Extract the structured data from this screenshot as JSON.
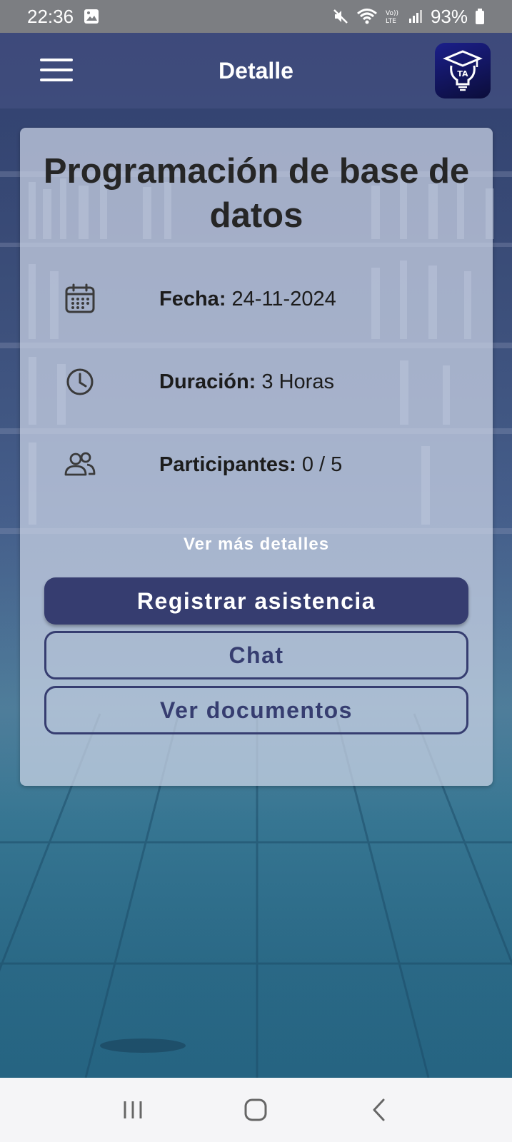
{
  "status_bar": {
    "time": "22:36",
    "battery": "93%",
    "icons": [
      "gallery-icon",
      "mute-icon",
      "wifi-icon",
      "volte-icon",
      "signal-icon",
      "battery-icon"
    ]
  },
  "app_bar": {
    "title": "Detalle",
    "menu_icon": "hamburger-menu-icon",
    "logo_text": "TA"
  },
  "card": {
    "title": "Programación de base de datos",
    "rows": [
      {
        "icon": "calendar-icon",
        "label": "Fecha:",
        "value": " 24-11-2024"
      },
      {
        "icon": "clock-icon",
        "label": "Duración:",
        "value": " 3 Horas"
      },
      {
        "icon": "participants-icon",
        "label": "Participantes:",
        "value": " 0 / 5"
      }
    ],
    "more_link": "Ver más detalles",
    "buttons": {
      "register": "Registrar asistencia",
      "chat": "Chat",
      "documents": "Ver documentos"
    }
  },
  "nav_bar": {
    "icons": [
      "recents-icon",
      "home-icon",
      "back-icon"
    ]
  },
  "colors": {
    "primary": "#363d70",
    "status_bar": "#7c7e82",
    "app_bar": "#46508f",
    "card": "#cdd6e8"
  }
}
